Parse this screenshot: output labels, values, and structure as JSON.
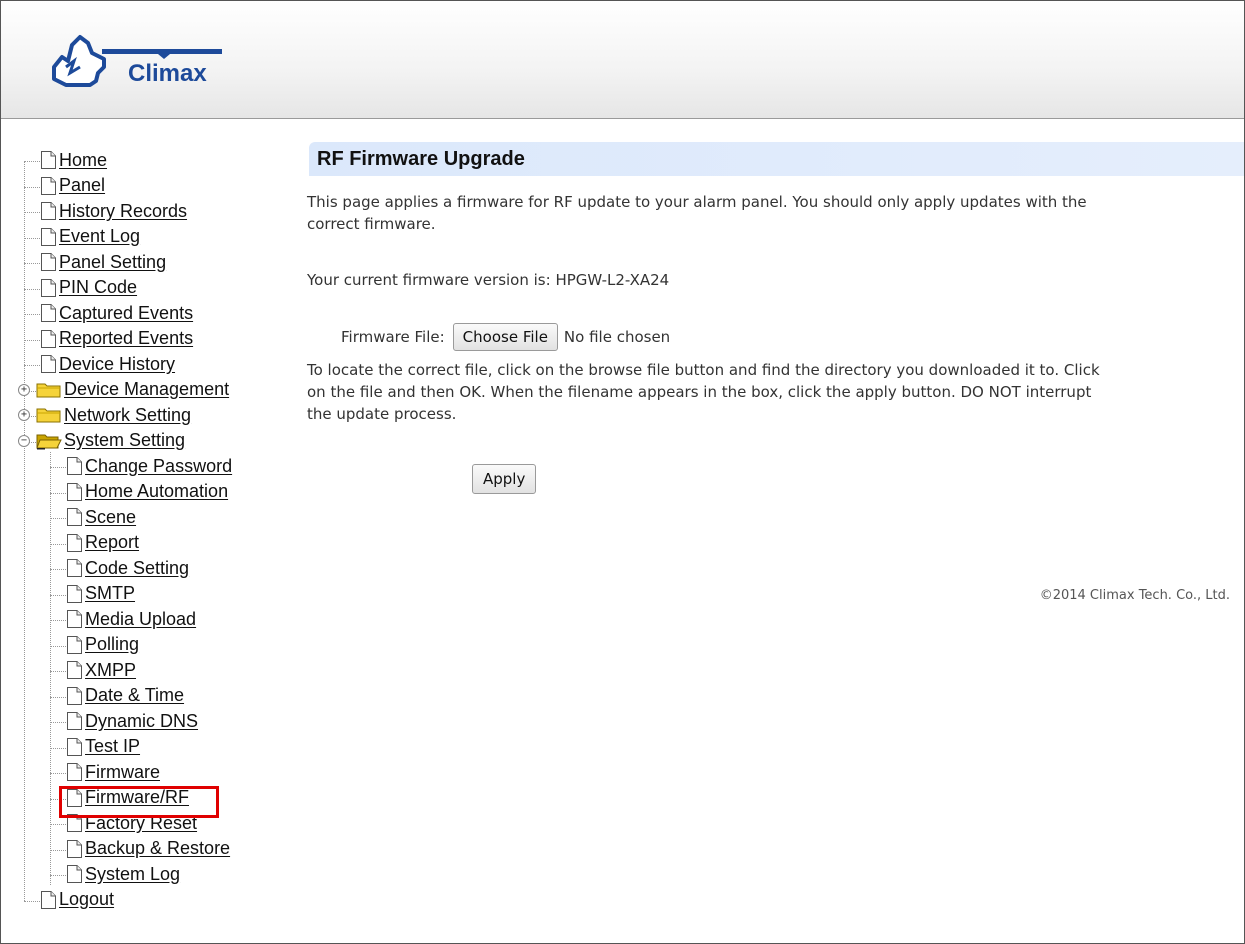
{
  "header": {
    "brand": "Climax"
  },
  "sidebar": {
    "items": [
      {
        "label": "Home",
        "type": "file",
        "level": 0
      },
      {
        "label": "Panel",
        "type": "file",
        "level": 0
      },
      {
        "label": "History Records",
        "type": "file",
        "level": 0
      },
      {
        "label": "Event Log",
        "type": "file",
        "level": 0
      },
      {
        "label": "Panel Setting",
        "type": "file",
        "level": 0
      },
      {
        "label": "PIN Code",
        "type": "file",
        "level": 0
      },
      {
        "label": "Captured Events",
        "type": "file",
        "level": 0
      },
      {
        "label": "Reported Events",
        "type": "file",
        "level": 0
      },
      {
        "label": "Device History",
        "type": "file",
        "level": 0
      },
      {
        "label": "Device Management",
        "type": "folder",
        "level": 0,
        "expander": "+"
      },
      {
        "label": "Network Setting",
        "type": "folder",
        "level": 0,
        "expander": "+"
      },
      {
        "label": "System Setting",
        "type": "folder-open",
        "level": 0,
        "expander": "−"
      },
      {
        "label": "Change Password",
        "type": "file",
        "level": 1
      },
      {
        "label": "Home Automation",
        "type": "file",
        "level": 1
      },
      {
        "label": "Scene",
        "type": "file",
        "level": 1
      },
      {
        "label": "Report",
        "type": "file",
        "level": 1
      },
      {
        "label": "Code Setting",
        "type": "file",
        "level": 1
      },
      {
        "label": "SMTP",
        "type": "file",
        "level": 1
      },
      {
        "label": "Media Upload",
        "type": "file",
        "level": 1
      },
      {
        "label": "Polling",
        "type": "file",
        "level": 1
      },
      {
        "label": "XMPP",
        "type": "file",
        "level": 1
      },
      {
        "label": "Date & Time",
        "type": "file",
        "level": 1
      },
      {
        "label": "Dynamic DNS",
        "type": "file",
        "level": 1
      },
      {
        "label": "Test IP",
        "type": "file",
        "level": 1
      },
      {
        "label": "Firmware",
        "type": "file",
        "level": 1
      },
      {
        "label": "Firmware/RF",
        "type": "file",
        "level": 1,
        "highlighted": true
      },
      {
        "label": "Factory Reset",
        "type": "file",
        "level": 1
      },
      {
        "label": "Backup & Restore",
        "type": "file",
        "level": 1
      },
      {
        "label": "System Log",
        "type": "file",
        "level": 1
      },
      {
        "label": "Logout",
        "type": "file",
        "level": 0
      }
    ]
  },
  "main": {
    "title": "RF Firmware Upgrade",
    "intro_line1": "This page applies a firmware for RF update to your alarm panel. You should only apply updates with the",
    "intro_line2": "correct firmware.",
    "current_version": "Your current firmware version is: HPGW-L2-XA24",
    "firmware_file_label": "Firmware File:",
    "choose_file_label": "Choose File",
    "no_file_text": "No file chosen",
    "help_line1": "To locate the correct file, click on the browse file button and find the directory you downloaded it to. Click",
    "help_line2": "on the file and then OK. When the filename appears in the box, click the apply button. DO NOT interrupt",
    "help_line3": "the update process.",
    "apply_label": "Apply",
    "copyright": "©2014 Climax Tech. Co., Ltd."
  },
  "colors": {
    "title_bar": "#dbe8fb",
    "highlight": "#e00000",
    "logo_blue": "#1d4a9a"
  },
  "icons": [
    "logo-icon",
    "file-icon",
    "folder-icon",
    "folder-open-icon",
    "expand-plus-icon",
    "collapse-minus-icon"
  ]
}
